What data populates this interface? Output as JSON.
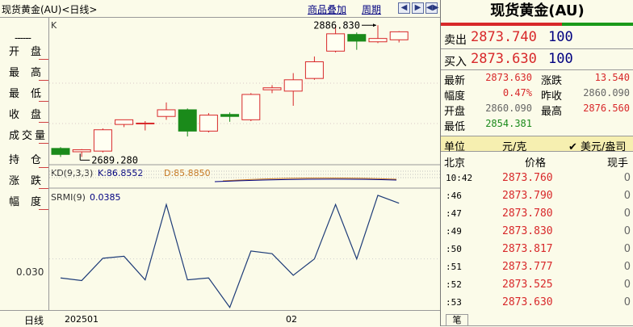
{
  "window": {
    "title": "现货黄金(AU)<日线>",
    "overlay_label": "商品叠加",
    "period_label": "周期",
    "nav_buttons": [
      "◀",
      "▶",
      "◀▶",
      "▶◀"
    ]
  },
  "left_panel": {
    "dash": "------",
    "labels": [
      "开盘",
      "最高",
      "最低",
      "收盘",
      "成交量",
      "持仓",
      "涨跌",
      "幅度"
    ],
    "srmi_tick": "0.030"
  },
  "x_axis": {
    "period": "日线",
    "labels": [
      "202501",
      "02"
    ]
  },
  "chart_data": [
    {
      "type": "candlestick",
      "title": "K",
      "ylim": [
        2680,
        2892
      ],
      "candles": [
        {
          "open": 2702,
          "high": 2704,
          "low": 2689.28,
          "close": 2693
        },
        {
          "open": 2697,
          "high": 2701,
          "low": 2689.28,
          "close": 2700
        },
        {
          "open": 2698,
          "high": 2732,
          "low": 2696,
          "close": 2730
        },
        {
          "open": 2738,
          "high": 2745,
          "low": 2734,
          "close": 2745
        },
        {
          "open": 2740,
          "high": 2743,
          "low": 2729,
          "close": 2740
        },
        {
          "open": 2750,
          "high": 2771,
          "low": 2745,
          "close": 2760
        },
        {
          "open": 2760,
          "high": 2762,
          "low": 2720,
          "close": 2728
        },
        {
          "open": 2728,
          "high": 2755,
          "low": 2726,
          "close": 2752
        },
        {
          "open": 2753,
          "high": 2756,
          "low": 2742,
          "close": 2750
        },
        {
          "open": 2745,
          "high": 2785,
          "low": 2743,
          "close": 2783
        },
        {
          "open": 2790,
          "high": 2797,
          "low": 2785,
          "close": 2793
        },
        {
          "open": 2788,
          "high": 2815,
          "low": 2766,
          "close": 2805
        },
        {
          "open": 2807,
          "high": 2840,
          "low": 2805,
          "close": 2832
        },
        {
          "open": 2848,
          "high": 2886.83,
          "low": 2846,
          "close": 2874
        },
        {
          "open": 2873,
          "high": 2876,
          "low": 2850,
          "close": 2863
        },
        {
          "open": 2862,
          "high": 2886.83,
          "low": 2860,
          "close": 2867
        },
        {
          "open": 2865,
          "high": 2878,
          "low": 2861,
          "close": 2877
        }
      ],
      "annotations": [
        {
          "text": "2886.830",
          "candle": 15,
          "value": 2886.83
        },
        {
          "text": "2689.280",
          "candle": 1,
          "value": 2689.28
        }
      ],
      "colors": {
        "up": "#d8282a",
        "down": "#1a8a1a"
      }
    },
    {
      "type": "line",
      "title": "KD(9,3,3)",
      "series": [
        {
          "name": "K",
          "label": "K:86.8552",
          "color": "#000080"
        },
        {
          "name": "D",
          "label": "D:85.8850",
          "color": "#c87820"
        }
      ]
    },
    {
      "type": "line",
      "title": "SRMI(9)",
      "value_label": "0.0385",
      "ylim": [
        0.0222,
        0.0408
      ],
      "yticks": [
        0.03
      ],
      "series": [
        {
          "name": "SRMI",
          "color": "#1e3c78",
          "values": [
            0.0271,
            0.0267,
            0.0301,
            0.0304,
            0.0268,
            0.0383,
            0.0268,
            0.0271,
            0.0226,
            0.0312,
            0.0308,
            0.0275,
            0.03,
            0.0383,
            0.03,
            0.0397,
            0.0385
          ]
        }
      ]
    }
  ],
  "quote": {
    "title": "现货黄金(AU)",
    "sell": {
      "label": "卖出",
      "price": "2873.740",
      "volume": "100"
    },
    "buy": {
      "label": "买入",
      "price": "2873.630",
      "volume": "100"
    },
    "stats": [
      {
        "label": "最新",
        "value": "2873.630",
        "color": "red",
        "label2": "涨跌",
        "value2": "13.540",
        "color2": "red"
      },
      {
        "label": "幅度",
        "value": "0.47%",
        "color": "red",
        "label2": "昨收",
        "value2": "2860.090",
        "color2": "grey"
      },
      {
        "label": "开盘",
        "value": "2860.090",
        "color": "grey",
        "label2": "最高",
        "value2": "2876.560",
        "color2": "red"
      },
      {
        "label": "最低",
        "value": "2854.381",
        "color": "green"
      }
    ],
    "unit_label": "单位",
    "unit_value": "元/克",
    "unit_option": "✔ 美元/盎司",
    "tick_headers": {
      "city": "北京",
      "price": "价格",
      "volume": "现手"
    },
    "ticks": [
      {
        "time": "10:42",
        "price": "2873.760",
        "volume": "0"
      },
      {
        "time": ":46",
        "price": "2873.790",
        "volume": "0"
      },
      {
        "time": ":47",
        "price": "2873.780",
        "volume": "0"
      },
      {
        "time": ":49",
        "price": "2873.830",
        "volume": "0"
      },
      {
        "time": ":50",
        "price": "2873.817",
        "volume": "0"
      },
      {
        "time": ":51",
        "price": "2873.777",
        "volume": "0"
      },
      {
        "time": ":52",
        "price": "2873.525",
        "volume": "0"
      },
      {
        "time": ":53",
        "price": "2873.630",
        "volume": "0"
      }
    ],
    "bottom_tab": "笔"
  }
}
